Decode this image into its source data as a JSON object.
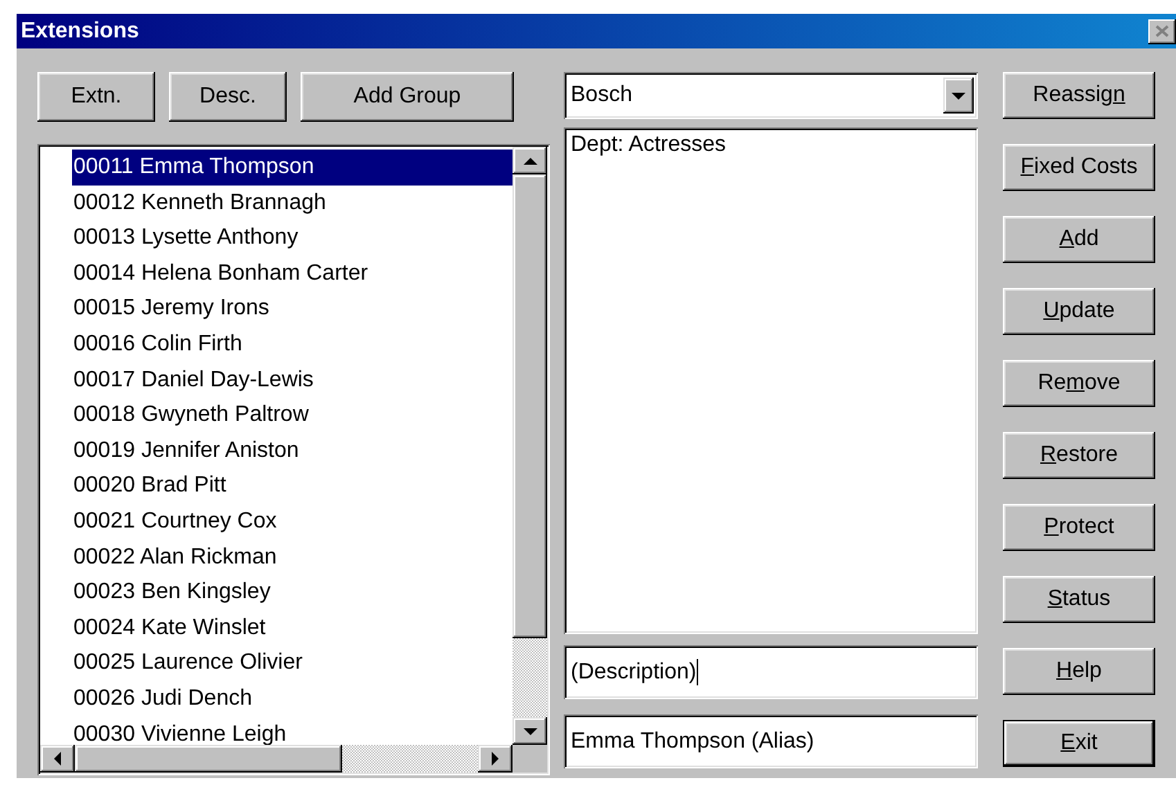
{
  "window": {
    "title": "Extensions"
  },
  "sort_buttons": [
    {
      "label": "Extn."
    },
    {
      "label": "Desc."
    },
    {
      "label": "Add Group"
    }
  ],
  "extensions": [
    {
      "label": "00011 Emma Thompson",
      "selected": true
    },
    {
      "label": "00012 Kenneth Brannagh",
      "selected": false
    },
    {
      "label": "00013 Lysette Anthony",
      "selected": false
    },
    {
      "label": "00014 Helena Bonham Carter",
      "selected": false
    },
    {
      "label": "00015 Jeremy Irons",
      "selected": false
    },
    {
      "label": "00016 Colin Firth",
      "selected": false
    },
    {
      "label": "00017 Daniel Day-Lewis",
      "selected": false
    },
    {
      "label": "00018 Gwyneth Paltrow",
      "selected": false
    },
    {
      "label": "00019 Jennifer Aniston",
      "selected": false
    },
    {
      "label": "00020 Brad Pitt",
      "selected": false
    },
    {
      "label": "00021 Courtney Cox",
      "selected": false
    },
    {
      "label": "00022 Alan Rickman",
      "selected": false
    },
    {
      "label": "00023 Ben Kingsley",
      "selected": false
    },
    {
      "label": "00024 Kate Winslet",
      "selected": false
    },
    {
      "label": "00025 Laurence Olivier",
      "selected": false
    },
    {
      "label": "00026 Judi Dench",
      "selected": false
    },
    {
      "label": "00030 Vivienne Leigh",
      "selected": false
    }
  ],
  "group_select": {
    "value": "Bosch"
  },
  "details": {
    "text": "Dept: Actresses"
  },
  "description_field": {
    "value": "(Description)",
    "focused": true
  },
  "alias_field": {
    "value": "Emma Thompson (Alias)"
  },
  "actions": [
    {
      "before": "Reassig",
      "key": "n",
      "default": false
    },
    {
      "key": "F",
      "after": "ixed Costs",
      "default": false
    },
    {
      "key": "A",
      "after": "dd",
      "default": false
    },
    {
      "key": "U",
      "after": "pdate",
      "default": false
    },
    {
      "before": "Re",
      "key": "m",
      "after": "ove",
      "default": false
    },
    {
      "key": "R",
      "after": "estore",
      "default": false
    },
    {
      "key": "P",
      "after": "rotect",
      "default": false
    },
    {
      "key": "S",
      "after": "tatus",
      "default": false
    },
    {
      "key": "H",
      "after": "elp",
      "default": false
    },
    {
      "key": "E",
      "after": "xit",
      "default": true
    }
  ]
}
